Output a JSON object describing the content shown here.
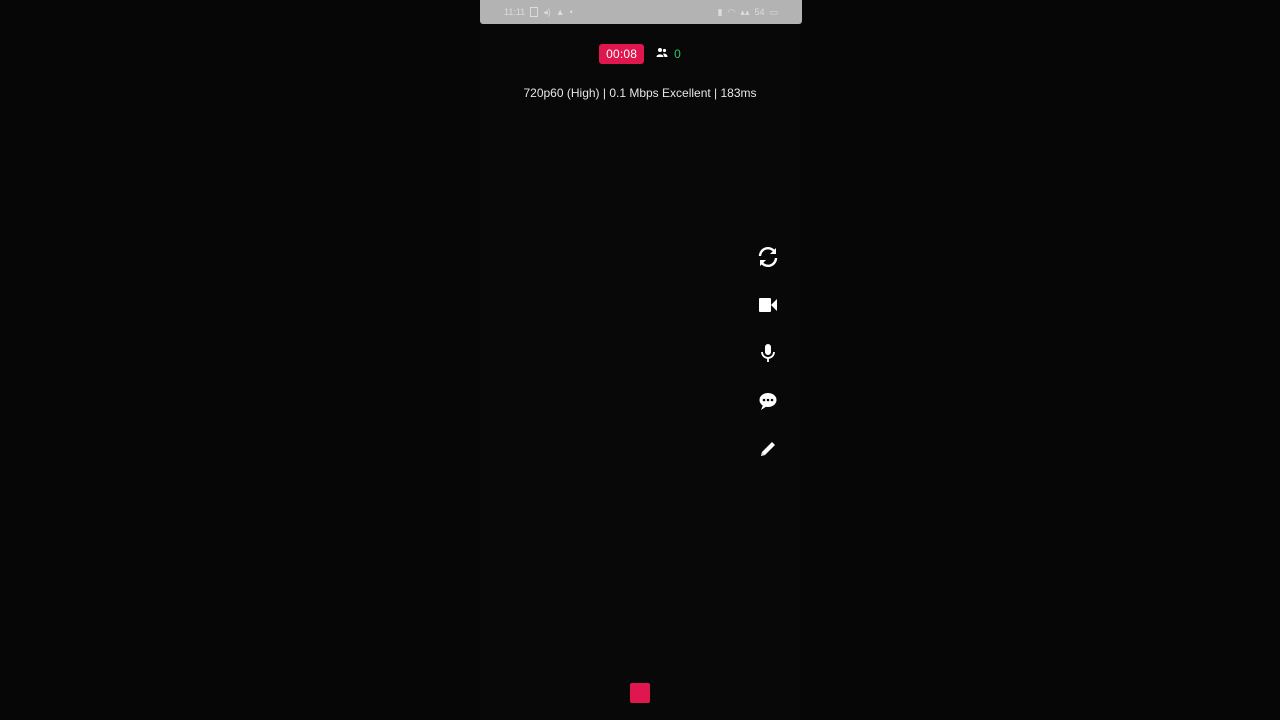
{
  "status_bar": {
    "time": "11:11",
    "battery": "54"
  },
  "stream": {
    "timer": "00:08",
    "viewer_count": "0",
    "stats": "720p60 (High) | 0.1 Mbps Excellent | 183ms"
  },
  "controls": [
    {
      "icon": "switch-camera-icon"
    },
    {
      "icon": "video-camera-icon"
    },
    {
      "icon": "microphone-icon"
    },
    {
      "icon": "chat-icon"
    },
    {
      "icon": "pencil-icon"
    }
  ],
  "colors": {
    "accent": "#e0164e",
    "viewer_count": "#27c76f",
    "background": "#080808"
  }
}
